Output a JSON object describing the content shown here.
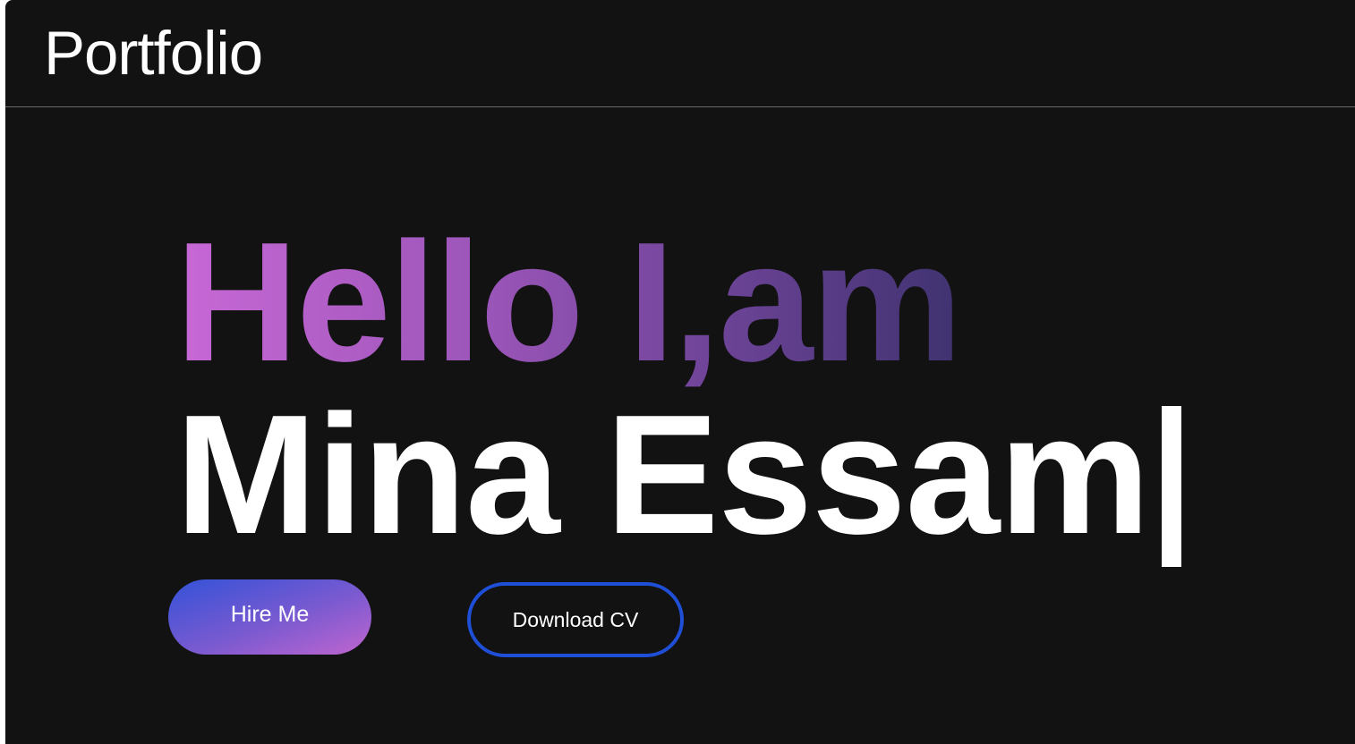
{
  "navbar": {
    "brand": "Portfolio"
  },
  "hero": {
    "greeting": "Hello I,am",
    "name": "Mina Essam",
    "typing_cursor": true,
    "gradient_colors": [
      "#c868d6",
      "#3f3270"
    ]
  },
  "buttons": {
    "hire_label": "Hire Me",
    "download_label": "Download CV"
  },
  "colors": {
    "background": "#121212",
    "accent_blue": "#1f4fd6",
    "accent_purple": "#c065cf"
  }
}
